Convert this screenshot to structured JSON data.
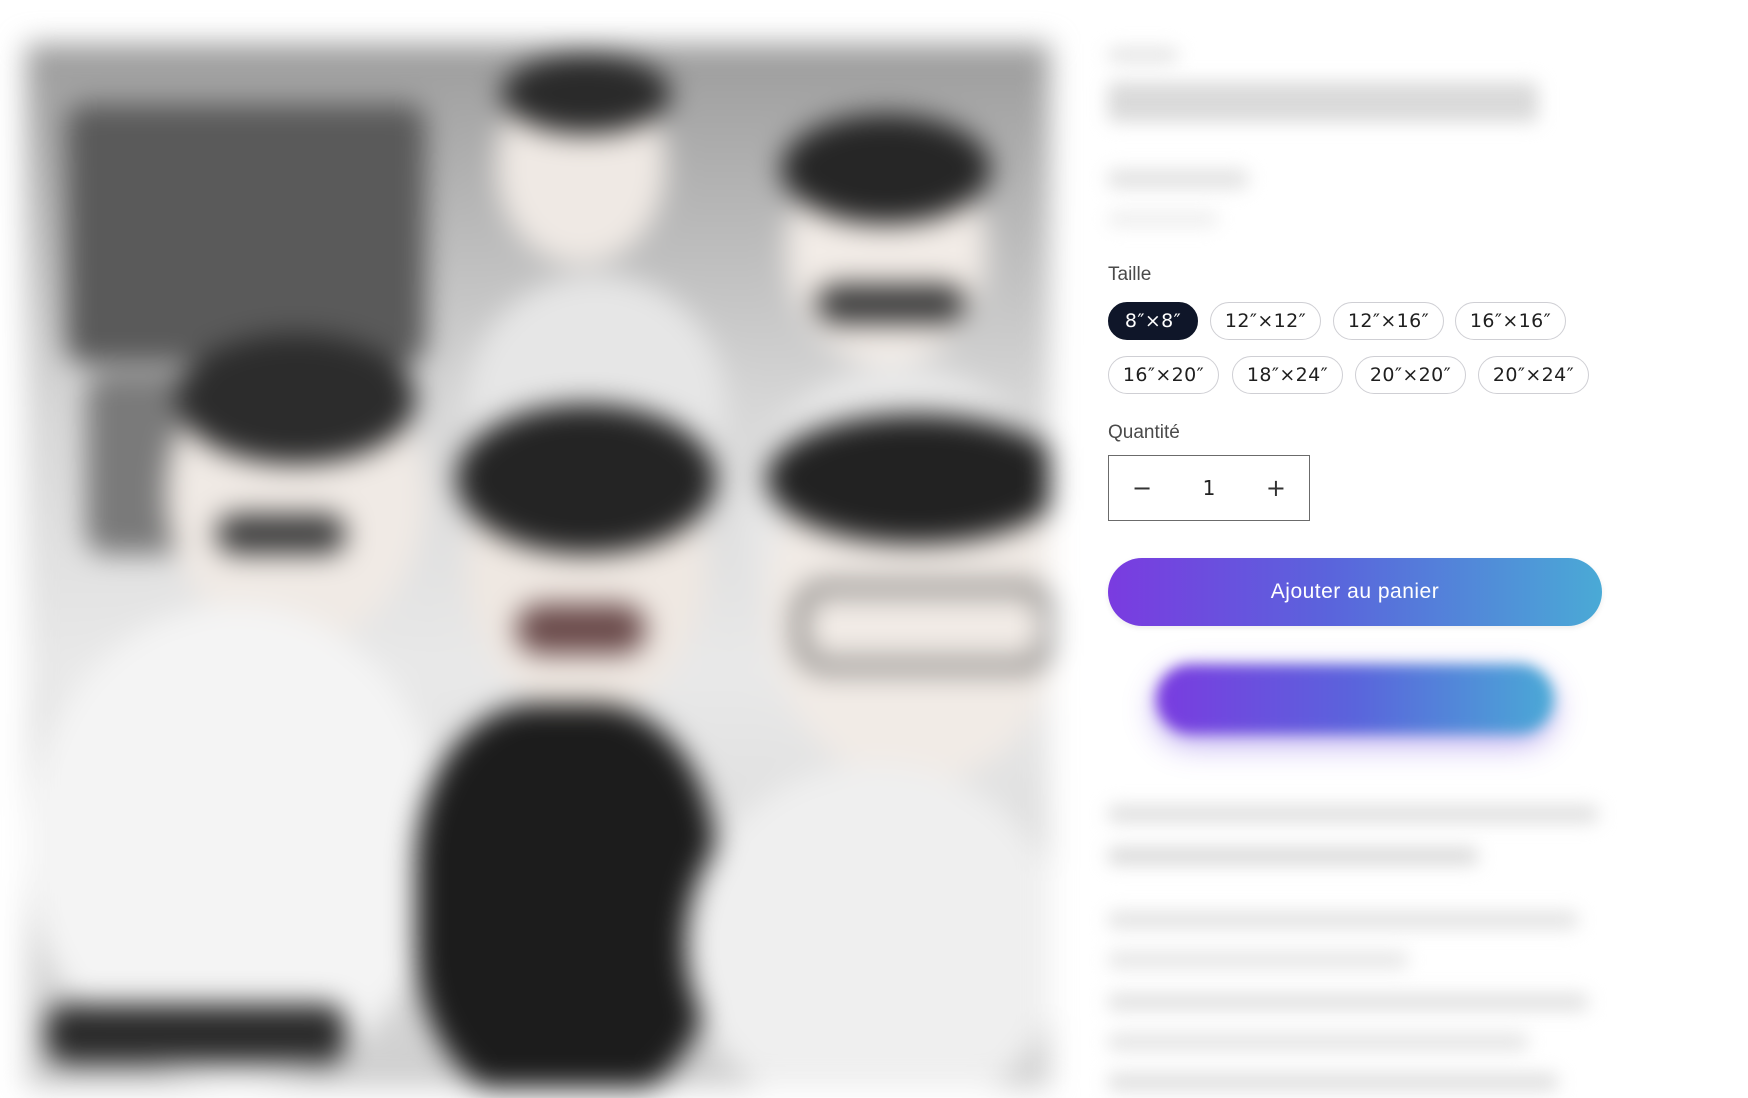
{
  "product": {
    "size_label": "Taille",
    "sizes": [
      "8″×8″",
      "12″×12″",
      "12″×16″",
      "16″×16″",
      "16″×20″",
      "18″×24″",
      "20″×20″",
      "20″×24″"
    ],
    "selected_size": "8″×8″",
    "quantity_label": "Quantité",
    "quantity_value": "1",
    "add_to_cart_label": "Ajouter au panier"
  },
  "icons": {
    "decrease": "minus-icon",
    "increase": "plus-icon"
  },
  "colors": {
    "selected_pill_bg": "#0f1629",
    "cta_gradient_start": "#7a3be0",
    "cta_gradient_end": "#4aaad6"
  }
}
